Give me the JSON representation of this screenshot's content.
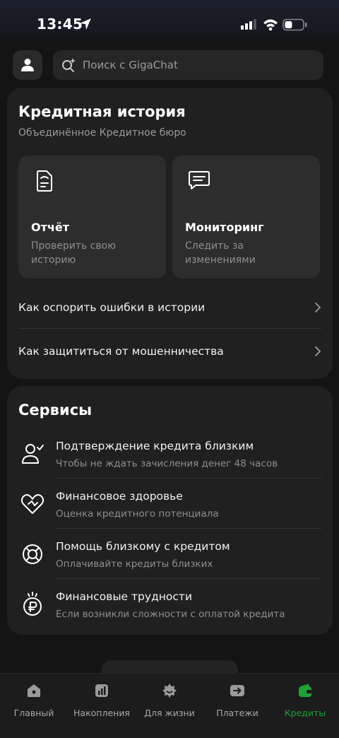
{
  "status_bar": {
    "time": "13:45"
  },
  "search": {
    "placeholder": "Поиск с GigaChat"
  },
  "credit_history": {
    "title": "Кредитная история",
    "subtitle": "Объединённое Кредитное бюро",
    "tiles": [
      {
        "title": "Отчёт",
        "description": "Проверить свою историю",
        "icon": "document-icon"
      },
      {
        "title": "Мониторинг",
        "description": "Следить за изменениями",
        "icon": "message-icon"
      }
    ],
    "links": [
      {
        "label": "Как оспорить ошибки в истории"
      },
      {
        "label": "Как защититься от мошенничества"
      }
    ]
  },
  "services": {
    "title": "Сервисы",
    "items": [
      {
        "title": "Подтверждение кредита близким",
        "subtitle": "Чтобы не ждать зачисления денег 48 часов",
        "icon": "person-check-icon"
      },
      {
        "title": "Финансовое здоровье",
        "subtitle": "Оценка кредитного потенциала",
        "icon": "heart-icon"
      },
      {
        "title": "Помощь близкому с кредитом",
        "subtitle": "Оплачивайте кредиты близких",
        "icon": "lifebuoy-icon"
      },
      {
        "title": "Финансовые трудности",
        "subtitle": "Если возникли сложности с оплатой кредита",
        "icon": "ruble-coin-icon"
      }
    ]
  },
  "tabbar": {
    "tabs": [
      {
        "label": "Главный",
        "icon": "home-icon"
      },
      {
        "label": "Накопления",
        "icon": "chart-icon"
      },
      {
        "label": "Для жизни",
        "icon": "gift-icon"
      },
      {
        "label": "Платежи",
        "icon": "arrow-icon"
      },
      {
        "label": "Кредиты",
        "icon": "wallet-icon",
        "active": true
      }
    ]
  },
  "colors": {
    "accent": "#21a038",
    "background": "#141414",
    "card": "#202020",
    "tile": "#2d2d2d"
  }
}
